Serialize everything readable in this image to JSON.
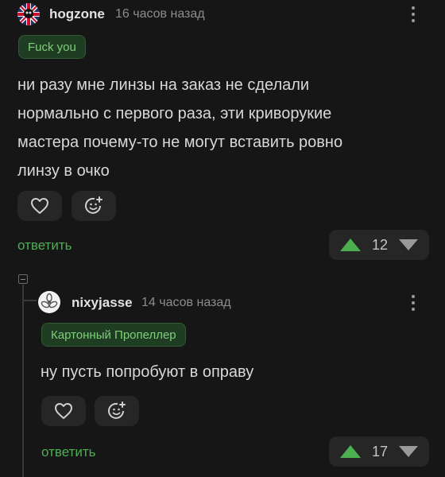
{
  "comments": [
    {
      "username": "hogzone",
      "time": "16 часов назад",
      "badge": "Fuck you",
      "text_lines": [
        "ни разу мне линзы на заказ не сделали",
        "нормально с первого раза, эти криворукие",
        "мастера почему-то не могут вставить ровно",
        "линзу в очко"
      ],
      "reply_label": "ответить",
      "votes": "12",
      "avatar_icon": "uk-flag-skull-avatar-icon"
    },
    {
      "username": "nixyjasse",
      "time": "14 часов назад",
      "badge": "Картонный Пропеллер",
      "text_lines": [
        "ну пусть попробуют в оправу"
      ],
      "reply_label": "ответить",
      "votes": "17",
      "avatar_icon": "propeller-avatar-icon"
    }
  ],
  "colors": {
    "background": "#161616",
    "accent_green": "#4caf50",
    "badge_bg": "#1f3d22",
    "badge_text": "#7fce7a"
  }
}
